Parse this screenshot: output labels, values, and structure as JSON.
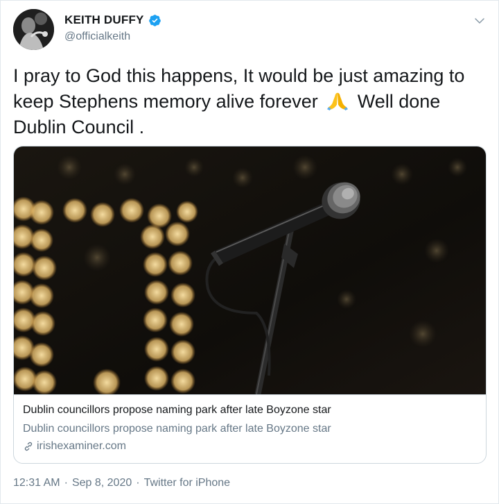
{
  "user": {
    "display_name": "KEITH DUFFY",
    "handle": "@officialkeith",
    "verified": true
  },
  "tweet": {
    "text_before_emoji": "I pray to God this happens, It would be just amazing to keep Stephens memory alive forever",
    "emoji": "folded-hands-emoji",
    "text_after_emoji": "Well done Dublin Council ."
  },
  "card": {
    "title": "Dublin councillors propose naming park after late Boyzone star",
    "description": "Dublin councillors propose naming park after late Boyzone star",
    "domain": "irishexaminer.com"
  },
  "meta": {
    "time": "12:31 AM",
    "separator": "·",
    "date": "Sep 8, 2020",
    "source": "Twitter for iPhone"
  },
  "colors": {
    "text": "#14171a",
    "secondary": "#657786",
    "verified_badge": "#1da1f2",
    "border": "#ccd6dd"
  }
}
